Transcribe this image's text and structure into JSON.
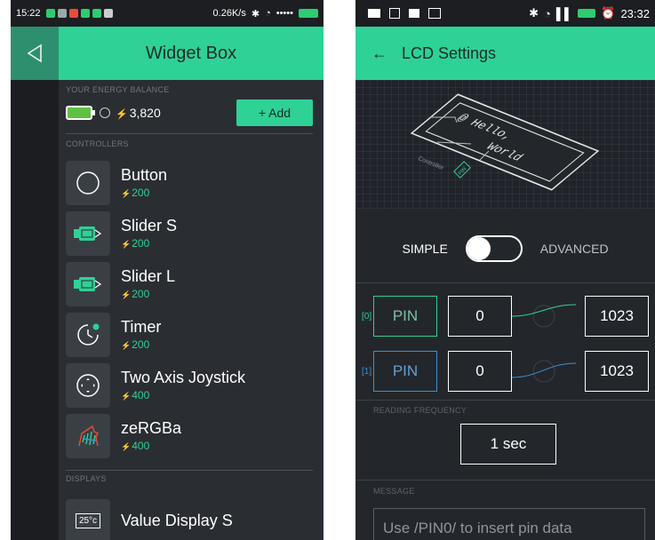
{
  "left": {
    "status": {
      "time": "15:22",
      "speed": "0.26K/s"
    },
    "header": {
      "title": "Widget Box"
    },
    "energy": {
      "label": "YOUR ENERGY BALANCE",
      "currency": "⚡",
      "value": "3,820",
      "add_label": "+ Add"
    },
    "controllers_label": "CONTROLLERS",
    "widgets": [
      {
        "name": "Button",
        "price": "200"
      },
      {
        "name": "Slider S",
        "price": "200"
      },
      {
        "name": "Slider L",
        "price": "200"
      },
      {
        "name": "Timer",
        "price": "200"
      },
      {
        "name": "Two Axis Joystick",
        "price": "400"
      },
      {
        "name": "zeRGBa",
        "price": "400"
      }
    ],
    "displays_label": "DISPLAYS",
    "display_widgets": [
      {
        "name": "Value Display S",
        "icon_text": "25°c"
      }
    ]
  },
  "right": {
    "status": {
      "time": "23:32"
    },
    "header": {
      "title": "LCD Settings"
    },
    "lcd": {
      "line1": "@ Hello,",
      "line2": "World",
      "controller": "Controller",
      "pin": "PIN"
    },
    "mode": {
      "simple": "SIMPLE",
      "advanced": "ADVANCED"
    },
    "pins": [
      {
        "index": "[0]",
        "label": "PIN",
        "min": "0",
        "max": "1023",
        "color": "#2ed196"
      },
      {
        "index": "[1]",
        "label": "PIN",
        "min": "0",
        "max": "1023",
        "color": "#3d8fd6"
      }
    ],
    "frequency_label": "READING FREQUENCY",
    "frequency_value": "1 sec",
    "message_label": "MESSAGE",
    "message_placeholder": "Use /PIN0/ to insert pin data"
  },
  "colors": {
    "accent": "#2ed196",
    "blue": "#3d8fd6",
    "bg": "#23272b"
  }
}
